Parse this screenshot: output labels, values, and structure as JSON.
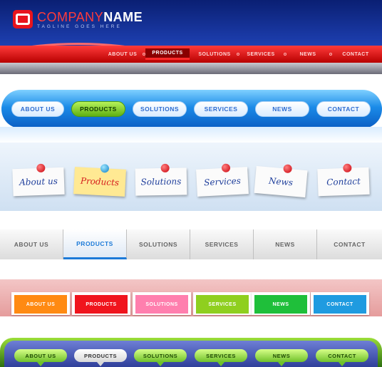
{
  "nav1": {
    "brand_red": "COMPANY",
    "brand_bold": "NAME",
    "tagline": "TAGLINE GOES HERE",
    "items": [
      "ABOUT US",
      "PRODUCTS",
      "SOLUTIONS",
      "SERVICES",
      "NEWS",
      "CONTACT"
    ],
    "active_index": 1,
    "accent": "#e8141d"
  },
  "nav2": {
    "items": [
      "ABOUT US",
      "PRODUCTS",
      "SOLUTIONS",
      "SERVICES",
      "NEWS",
      "CONTACT"
    ],
    "active_index": 1,
    "accent": "#5fb012"
  },
  "nav3": {
    "items": [
      "About us",
      "Products",
      "Solutions",
      "Services",
      "News",
      "Contact"
    ],
    "active_index": 1,
    "active_color": "#ffe993"
  },
  "nav4": {
    "items": [
      "ABOUT US",
      "PRODUCTS",
      "SOLUTIONS",
      "SERVICES",
      "NEWS",
      "CONTACT"
    ],
    "active_index": 1,
    "accent": "#1c7ad8"
  },
  "nav5": {
    "items": [
      "ABOUT US",
      "PRODUCTS",
      "SOLUTIONS",
      "SERVICES",
      "NEWS",
      "CONTACT"
    ],
    "colors": [
      "#ff8a12",
      "#f0141d",
      "#ff7fae",
      "#8fcf1f",
      "#1fbf3a",
      "#1f9be0"
    ]
  },
  "nav6": {
    "items": [
      "ABOUT US",
      "PRODUCTS",
      "SOLUTIONS",
      "SERVICES",
      "NEWS",
      "CONTACT"
    ],
    "active_index": 1,
    "accent": "#6fc12a"
  }
}
